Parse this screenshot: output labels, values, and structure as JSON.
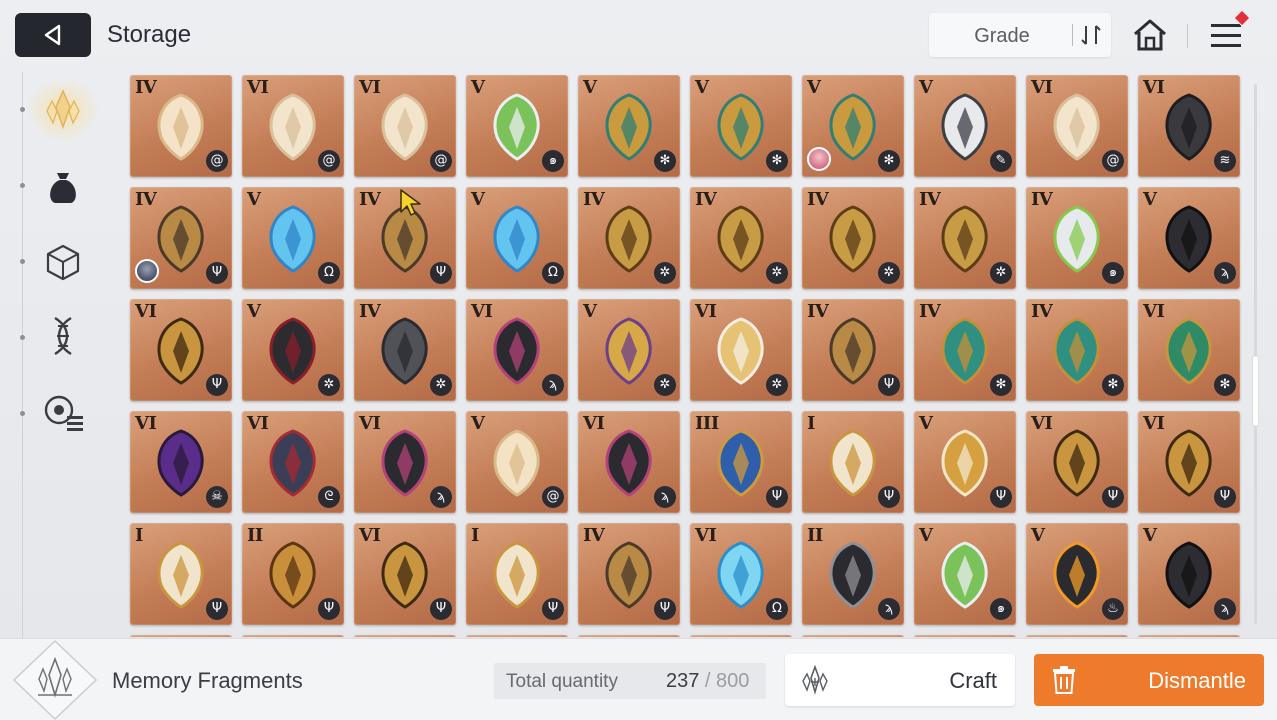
{
  "header": {
    "title": "Storage",
    "grade_sort_label": "Grade",
    "has_notification": true
  },
  "sidebar": {
    "items": [
      {
        "icon": "memory-fragment-icon",
        "active": true
      },
      {
        "icon": "pouch-icon",
        "active": false
      },
      {
        "icon": "cube-icon",
        "active": false
      },
      {
        "icon": "dna-icon",
        "active": false
      },
      {
        "icon": "list-settings-icon",
        "active": false
      }
    ]
  },
  "grid": {
    "rows": [
      [
        {
          "grade": "IV",
          "art": "pendant",
          "type": "swirl"
        },
        {
          "grade": "VI",
          "art": "feather-wing",
          "type": "swirl"
        },
        {
          "grade": "VI",
          "art": "feather-wing",
          "type": "swirl"
        },
        {
          "grade": "V",
          "art": "potion",
          "type": "swirl-drop"
        },
        {
          "grade": "V",
          "art": "chalice",
          "type": "bug"
        },
        {
          "grade": "V",
          "art": "chalice",
          "type": "bug"
        },
        {
          "grade": "V",
          "art": "chalice",
          "type": "bug",
          "portrait": "pink"
        },
        {
          "grade": "V",
          "art": "robot",
          "type": "pen"
        },
        {
          "grade": "VI",
          "art": "feather-wing",
          "type": "swirl"
        },
        {
          "grade": "VI",
          "art": "dark-wing",
          "type": "claw"
        }
      ],
      [
        {
          "grade": "IV",
          "art": "trident-amulet",
          "type": "trident",
          "portrait": "dark"
        },
        {
          "grade": "V",
          "art": "water-orb",
          "type": "libra"
        },
        {
          "grade": "IV",
          "art": "trident-amulet",
          "type": "trident"
        },
        {
          "grade": "V",
          "art": "water-orb",
          "type": "libra"
        },
        {
          "grade": "IV",
          "art": "gold-necklace",
          "type": "gear"
        },
        {
          "grade": "IV",
          "art": "gold-necklace",
          "type": "gear"
        },
        {
          "grade": "IV",
          "art": "gold-necklace",
          "type": "gear"
        },
        {
          "grade": "IV",
          "art": "gold-necklace",
          "type": "gear"
        },
        {
          "grade": "IV",
          "art": "vial-chain",
          "type": "swirl-drop"
        },
        {
          "grade": "V",
          "art": "dark-goblet",
          "type": "wing"
        }
      ],
      [
        {
          "grade": "VI",
          "art": "gold-crest",
          "type": "trident"
        },
        {
          "grade": "V",
          "art": "dark-lantern",
          "type": "gear"
        },
        {
          "grade": "IV",
          "art": "thorn-crown",
          "type": "gear"
        },
        {
          "grade": "VI",
          "art": "black-feather",
          "type": "wing"
        },
        {
          "grade": "V",
          "art": "trophy",
          "type": "gear"
        },
        {
          "grade": "VI",
          "art": "golden-blade",
          "type": "gear"
        },
        {
          "grade": "IV",
          "art": "trident-amulet",
          "type": "trident"
        },
        {
          "grade": "IV",
          "art": "scarab-necklace",
          "type": "bug"
        },
        {
          "grade": "IV",
          "art": "scarab-necklace",
          "type": "bug"
        },
        {
          "grade": "VI",
          "art": "green-feather",
          "type": "bug"
        }
      ],
      [
        {
          "grade": "VI",
          "art": "purple-creature",
          "type": "skull"
        },
        {
          "grade": "VI",
          "art": "red-beast",
          "type": "dragon"
        },
        {
          "grade": "VI",
          "art": "black-feather",
          "type": "wing"
        },
        {
          "grade": "V",
          "art": "ivory-mask",
          "type": "swirl"
        },
        {
          "grade": "VI",
          "art": "black-feather",
          "type": "wing"
        },
        {
          "grade": "III",
          "art": "blue-trident-shield",
          "type": "trident"
        },
        {
          "grade": "I",
          "art": "shield-trident",
          "type": "trident"
        },
        {
          "grade": "V",
          "art": "gold-lamp",
          "type": "trident"
        },
        {
          "grade": "VI",
          "art": "gold-crest",
          "type": "trident"
        },
        {
          "grade": "VI",
          "art": "gold-crest",
          "type": "trident"
        }
      ],
      [
        {
          "grade": "I",
          "art": "shield-trident",
          "type": "trident"
        },
        {
          "grade": "II",
          "art": "gold-key",
          "type": "trident"
        },
        {
          "grade": "VI",
          "art": "gold-crest",
          "type": "trident"
        },
        {
          "grade": "I",
          "art": "shield-trident",
          "type": "trident"
        },
        {
          "grade": "IV",
          "art": "trident-amulet",
          "type": "trident"
        },
        {
          "grade": "VI",
          "art": "ice-feather",
          "type": "libra"
        },
        {
          "grade": "II",
          "art": "black-key",
          "type": "wing"
        },
        {
          "grade": "V",
          "art": "potion",
          "type": "swirl-drop"
        },
        {
          "grade": "V",
          "art": "flame-goblet",
          "type": "flame"
        },
        {
          "grade": "V",
          "art": "dark-goblet",
          "type": "wing"
        }
      ],
      [
        {
          "grade": "",
          "art": "",
          "type": ""
        },
        {
          "grade": "",
          "art": "",
          "type": ""
        },
        {
          "grade": "",
          "art": "",
          "type": ""
        },
        {
          "grade": "",
          "art": "",
          "type": ""
        },
        {
          "grade": "",
          "art": "",
          "type": ""
        },
        {
          "grade": "",
          "art": "",
          "type": ""
        },
        {
          "grade": "",
          "art": "",
          "type": ""
        },
        {
          "grade": "",
          "art": "",
          "type": ""
        },
        {
          "grade": "",
          "art": "",
          "type": ""
        },
        {
          "grade": "",
          "art": "",
          "type": ""
        }
      ]
    ]
  },
  "footer": {
    "category_label": "Memory Fragments",
    "total_label": "Total quantity",
    "total_current": "237",
    "total_max": "800",
    "craft_label": "Craft",
    "dismantle_label": "Dismantle"
  },
  "colors": {
    "accent": "#ee7b2c",
    "tile": "#c47e57",
    "header_button": "#24272d"
  }
}
